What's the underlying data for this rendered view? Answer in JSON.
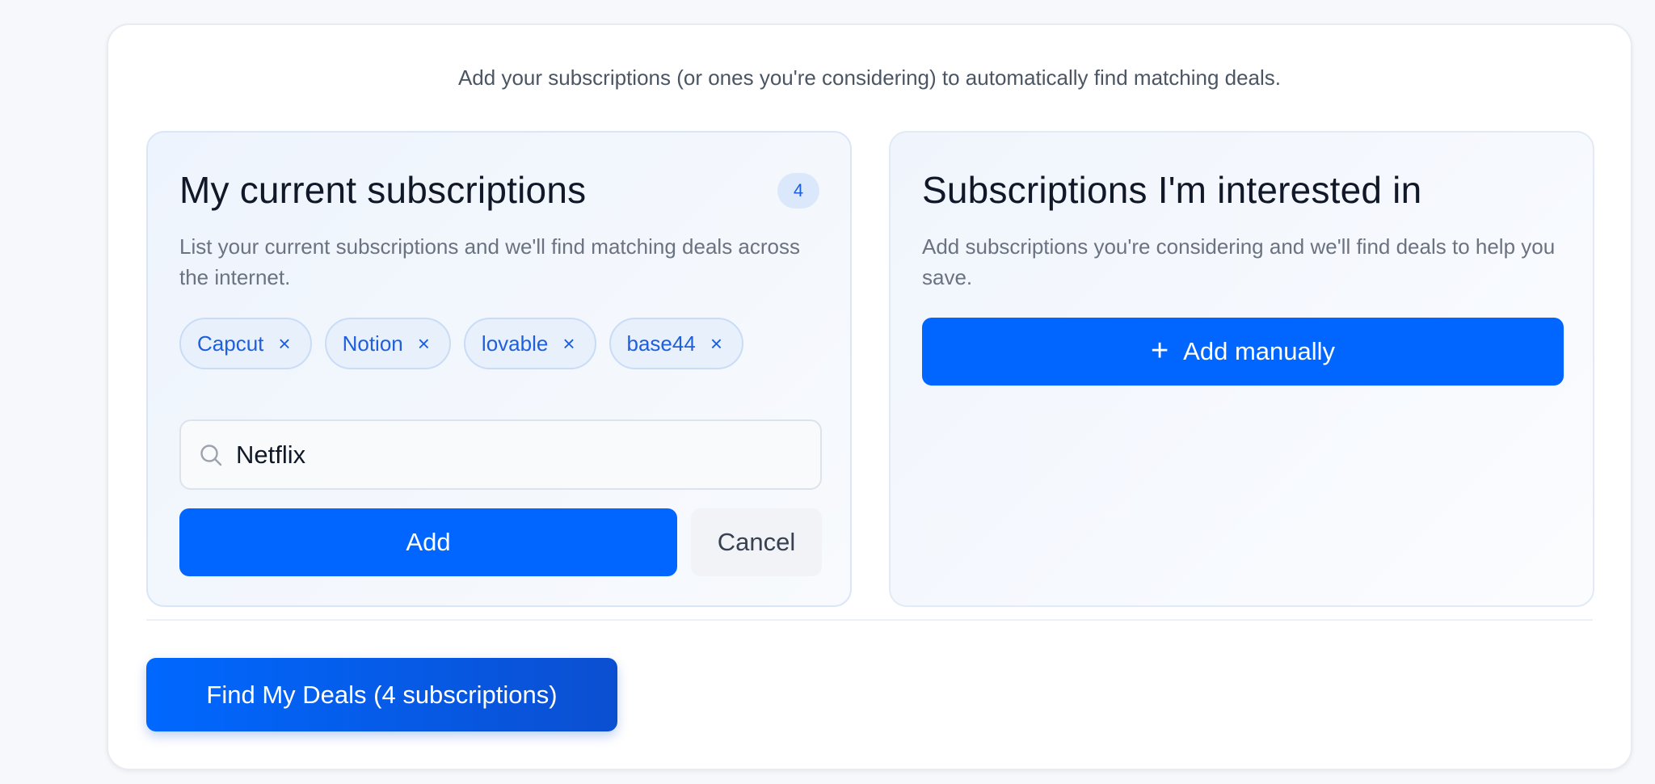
{
  "intro_text": "Add your subscriptions (or ones you're considering) to automatically find matching deals.",
  "current": {
    "title": "My current subscriptions",
    "count": "4",
    "description": "List your current subscriptions and we'll find matching deals across the internet.",
    "chips": [
      {
        "label": "Capcut",
        "remove_icon": "×"
      },
      {
        "label": "Notion",
        "remove_icon": "×"
      },
      {
        "label": "lovable",
        "remove_icon": "×"
      },
      {
        "label": "base44",
        "remove_icon": "×"
      }
    ],
    "search": {
      "value": "Netflix",
      "icon": "search-icon"
    },
    "add_label": "Add",
    "cancel_label": "Cancel"
  },
  "interested": {
    "title": "Subscriptions I'm interested in",
    "description": "Add subscriptions you're considering and we'll find deals to help you save.",
    "add_manually_icon": "+",
    "add_manually_label": "Add manually"
  },
  "find_deals_label": "Find My Deals (4 subscriptions)",
  "colors": {
    "primary": "#0066ff",
    "chip_bg": "#e8f0fc",
    "chip_text": "#1d5fdc"
  }
}
